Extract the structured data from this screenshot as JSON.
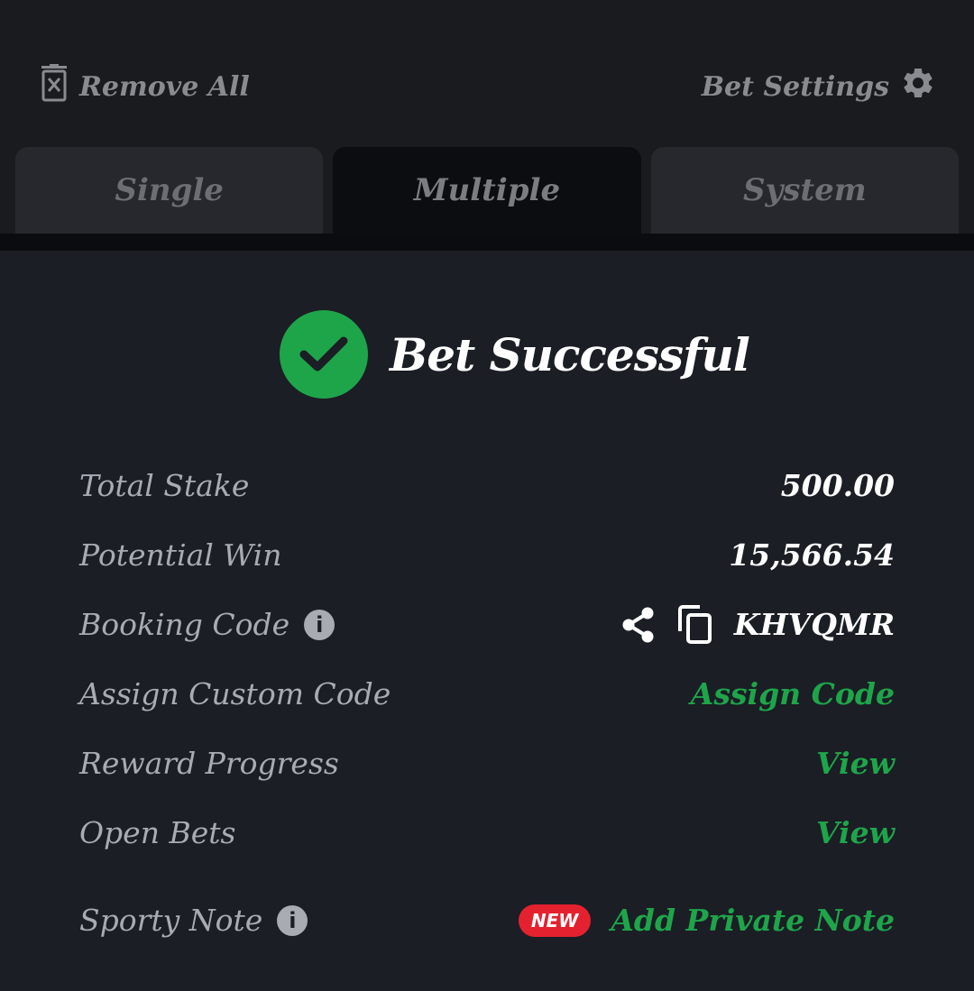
{
  "header": {
    "remove_all_label": "Remove All",
    "bet_settings_label": "Bet Settings"
  },
  "tabs": [
    {
      "label": "Single",
      "active": false
    },
    {
      "label": "Multiple",
      "active": true
    },
    {
      "label": "System",
      "active": false
    }
  ],
  "status": {
    "title": "Bet Successful"
  },
  "details": {
    "total_stake": {
      "label": "Total Stake",
      "value": "500.00"
    },
    "potential_win": {
      "label": "Potential Win",
      "value": "15,566.54"
    },
    "booking_code": {
      "label": "Booking Code",
      "value": "KHVQMR"
    },
    "custom_code": {
      "label": "Assign Custom Code",
      "action": "Assign Code"
    },
    "reward_progress": {
      "label": "Reward Progress",
      "action": "View"
    },
    "open_bets": {
      "label": "Open Bets",
      "action": "View"
    },
    "sporty_note": {
      "label": "Sporty Note",
      "badge": "NEW",
      "action": "Add Private Note"
    }
  },
  "colors": {
    "background": "#1a1b1f",
    "panel": "#1b1e25",
    "accent_green": "#1ea54a",
    "badge_red": "#e4222f"
  },
  "icons": {
    "remove_all": "trash-x-icon",
    "bet_settings": "gear-icon",
    "success": "check-circle-icon",
    "info": "info-icon",
    "share": "share-icon",
    "copy": "copy-icon"
  }
}
